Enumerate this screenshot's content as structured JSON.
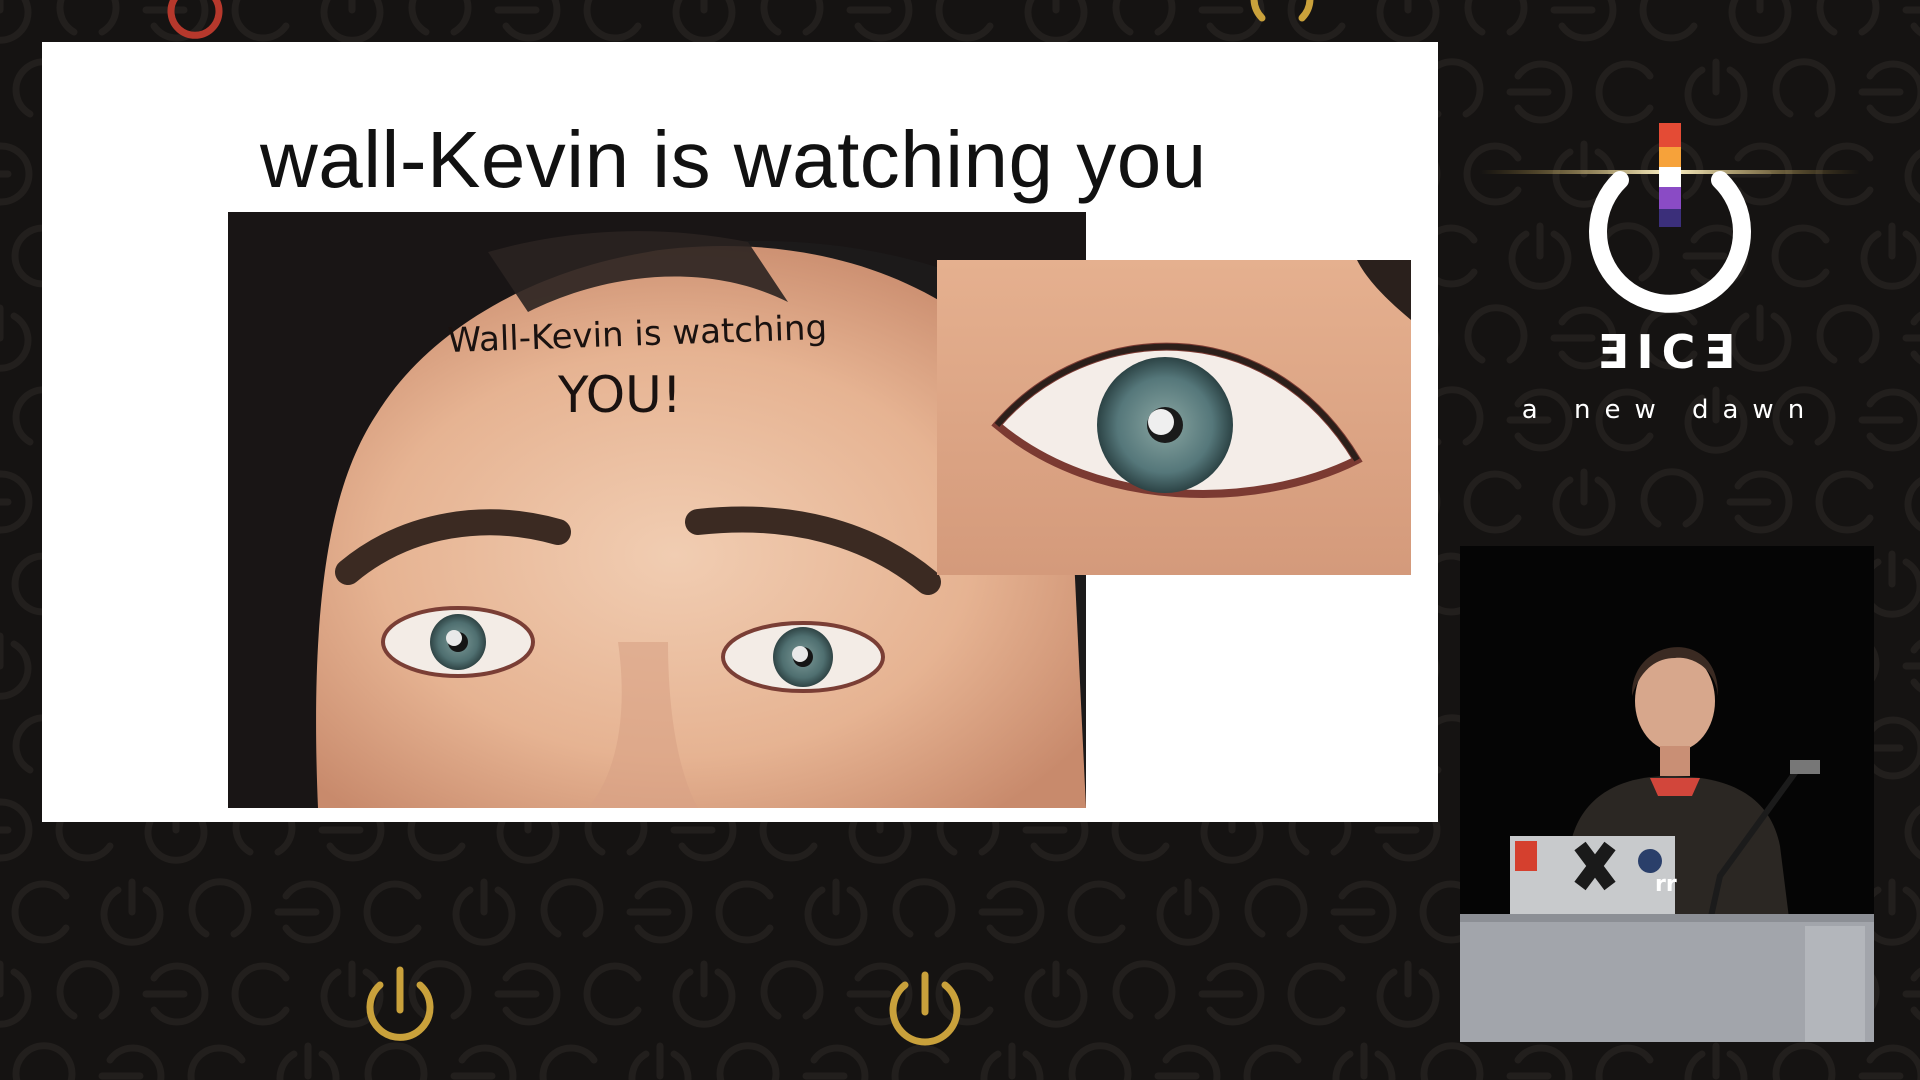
{
  "slide": {
    "title": "wall-Kevin is watching you",
    "photo_handwriting": [
      "Wall-Kevin is watching",
      "YOU!"
    ]
  },
  "logo": {
    "wordmark": "ƎICƎ",
    "tagline": "a new dawn"
  },
  "speaker_cam": {
    "laptop_sticker": "rr"
  },
  "colors": {
    "background": "#151312",
    "pattern": "#221f1d",
    "accent_gold": "#c9a13b",
    "accent_red": "#b6382c",
    "slide": "#ffffff"
  }
}
